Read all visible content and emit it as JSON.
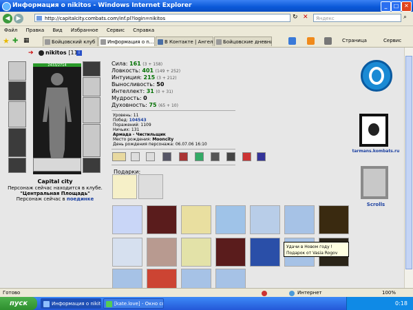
{
  "window": {
    "title": "Информация о nikitos - Windows Internet Explorer"
  },
  "address": {
    "url": "http://capitalcity.combats.com/inf.pl?login=nikitos",
    "search_placeholder": "Яндекс"
  },
  "menu": [
    "Файл",
    "Правка",
    "Вид",
    "Избранное",
    "Сервис",
    "Справка"
  ],
  "tabs": [
    "Бойцовский клуб",
    "Информация о n...",
    "В Контакте | Ангел...",
    "Бойцовские дневни..."
  ],
  "toolbar": {
    "page_label": "Страница",
    "tools_label": "Сервис"
  },
  "character": {
    "name": "nikitos",
    "level": "[11]",
    "hp": "2433/2714",
    "city": "Capital city",
    "loc1": "Персонаж сейчас находится в клубе.",
    "loc2": "\"Центральная Площадь\"",
    "loc3_prefix": "Персонаж сейчас в ",
    "loc3_link": "поединке"
  },
  "stats": [
    {
      "label": "Сила:",
      "value": "161",
      "extra": "(3 + 158)"
    },
    {
      "label": "Ловкость:",
      "value": "401",
      "extra": "(149 + 252)"
    },
    {
      "label": "Интуиция:",
      "value": "215",
      "extra": "(3 + 212)"
    },
    {
      "label": "Выносливость:",
      "value": "50",
      "extra": ""
    },
    {
      "label": "Интеллект:",
      "value": "31",
      "extra": "(0 + 31)"
    },
    {
      "label": "Мудрость:",
      "value": "0",
      "extra": ""
    },
    {
      "label": "Духовность:",
      "value": "75",
      "extra": "(65 + 10)"
    }
  ],
  "info": [
    {
      "label": "Уровень: ",
      "value": "11"
    },
    {
      "label": "Побед: ",
      "value": "104543"
    },
    {
      "label": "Поражений: ",
      "value": "1109"
    },
    {
      "label": "Ничьих: ",
      "value": "131"
    },
    {
      "label": "Армада - ",
      "value": "Чистильщик"
    },
    {
      "label": "Место рождения: ",
      "value": "Mooncity"
    },
    {
      "label": "День рождения персонажа: ",
      "value": "06.07.06 16:10"
    }
  ],
  "gifts_label": "Подарки:",
  "tooltip": {
    "line1": "Удачи в Новом году !",
    "line2": "Подарок от Vasia Rogov"
  },
  "sidebar": {
    "tarmans": "tarmans.kombats.ru",
    "scrolls": "Scrolls"
  },
  "status": {
    "left": "Готово",
    "zone": "Интернет",
    "zoom": "100%"
  },
  "taskbar": {
    "start": "пуск",
    "tasks": [
      "Информация о nikito...",
      "[kate.love] - Окно со..."
    ],
    "clock": "0:18"
  }
}
